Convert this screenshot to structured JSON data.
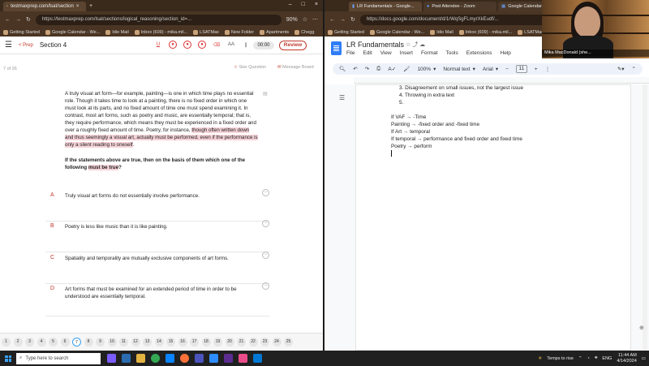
{
  "left_browser": {
    "tab_title": "testmaxprep.com/lsat/section",
    "url": "https://testmaxprep.com/lsat/sections/logical_reasoning/section_id=...",
    "zoom": "90%",
    "bookmarks": [
      "Getting Started",
      "Google Calendar - We...",
      "Idio Mail",
      "Inbox (609) - mika.mil...",
      "LSATMax",
      "New Folder",
      "Apartments",
      "Chegg"
    ]
  },
  "quiz": {
    "prep_label": "< Prep",
    "section_title": "Section 4",
    "timer": "00:00",
    "review_label": "Review",
    "question_counter": "7 of 26",
    "star_label": "Star Question",
    "message_label": "Message Board",
    "passage_before": "A truly visual art form—for example, painting—is one in which time plays no essential role. Though it takes time to look at a painting, there is no fixed order in which one must look at its parts, and no fixed amount of time one must spend examining it. In contrast, most art forms, such as poetry and music, are essentially temporal; that is, they require performance, which means they must be experienced in a fixed order and over a roughly fixed amount of time. Poetry, for instance, ",
    "passage_highlight": "though often written down and thus seemingly a visual art, actually must be performed, even if the performance is only a silent reading to oneself",
    "passage_after": ".",
    "stem_before": "If the statements above are true, then on the basis of them which one of the following ",
    "stem_highlight": "must be true",
    "stem_after": "?",
    "choices": [
      {
        "letter": "A",
        "text": "Truly visual art forms do not essentially involve performance."
      },
      {
        "letter": "B",
        "text": "Poetry is less like music than it is like painting."
      },
      {
        "letter": "C",
        "text": "Spatiality and temporality are mutually exclusive components of art forms."
      },
      {
        "letter": "D",
        "text": "Art forms that must be examined for an extended period of time in order to be understood are essentially temporal."
      }
    ],
    "question_numbers": [
      "1",
      "2",
      "3",
      "4",
      "5",
      "6",
      "7",
      "8",
      "9",
      "10",
      "11",
      "12",
      "13",
      "14",
      "15",
      "16",
      "17",
      "18",
      "19",
      "20",
      "21",
      "22",
      "23",
      "24",
      "25"
    ]
  },
  "right_browser": {
    "tabs": [
      "LR Fundamentals - Google...",
      "Post Attendee - Zoom",
      "Google Calendar - We..."
    ],
    "url": "https://docs.google.com/document/d/1rWqSgFLmyrXkEudf/...",
    "bookmarks": [
      "Getting Started",
      "Google Calendar - We...",
      "Idio Mail",
      "Inbox (609) - mika.mil...",
      "LSATMax"
    ]
  },
  "doc": {
    "title": "LR Fundamentals",
    "menu": [
      "File",
      "Edit",
      "View",
      "Insert",
      "Format",
      "Tools",
      "Extensions",
      "Help"
    ],
    "zoom": "100%",
    "style": "Normal text",
    "font": "Arial",
    "font_size": "11",
    "list_items": [
      "3.   Disagreement on small issues, not the largest issue",
      "4.   Throwing in extra text",
      "5."
    ],
    "lines": [
      "If VAF → -Time",
      "Painting → -fixed order and -fixed time",
      "If Art → temporal",
      "If temporal → performance and fixed order and fixed time",
      "Poetry → perform"
    ]
  },
  "webcam": {
    "name": "Mika MacDonald (she..."
  },
  "taskbar": {
    "search_placeholder": "Type here to search",
    "weather": "Temps to rise",
    "lang": "ENG",
    "time": "11:44 AM",
    "date": "4/14/2024"
  },
  "colors": {
    "accent_red": "#c0392b",
    "docs_blue": "#2f7df6",
    "highlight_pink": "#f5d3d8"
  }
}
